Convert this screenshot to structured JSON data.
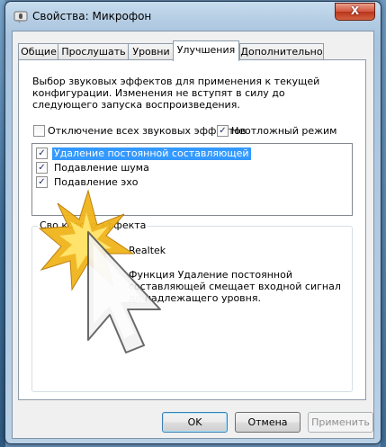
{
  "window": {
    "title": "Свойства: Микрофон",
    "close_glyph": "X"
  },
  "tabs": [
    {
      "label": "Общие",
      "active": false
    },
    {
      "label": "Прослушать",
      "active": false
    },
    {
      "label": "Уровни",
      "active": false
    },
    {
      "label": "Улучшения",
      "active": true
    },
    {
      "label": "Дополнительно",
      "active": false
    }
  ],
  "enhancements": {
    "description": "Выбор звуковых эффектов для применения к текущей конфигурации. Изменения не вступят в силу до следующего запуска воспроизведения.",
    "disable_all": {
      "label": "Отключение всех звуковых эффектов",
      "checked": false
    },
    "immediate_mode": {
      "label": "Неотложный режим",
      "checked": true
    },
    "effects": [
      {
        "label": "Удаление постоянной составляющей",
        "checked": true,
        "selected": true
      },
      {
        "label": "Подавление шума",
        "checked": true,
        "selected": false
      },
      {
        "label": "Подавление эхо",
        "checked": true,
        "selected": false
      }
    ],
    "group_title": "Сво       кового эффекта",
    "provider_value": "Realtek",
    "effect_description": "Функция Удаление постоянной составляющей смещает входной сигнал до надлежащего уровня."
  },
  "buttons": {
    "ok": "OK",
    "cancel": "Отмена",
    "apply": "Применить"
  },
  "icons": {
    "title": "microphone-icon",
    "cursor": "mouse-pointer-icon",
    "click": "click-burst-icon"
  },
  "colors": {
    "selection": "#3399ff",
    "close_button": "#c8452c",
    "burst": "#f0b51c"
  }
}
